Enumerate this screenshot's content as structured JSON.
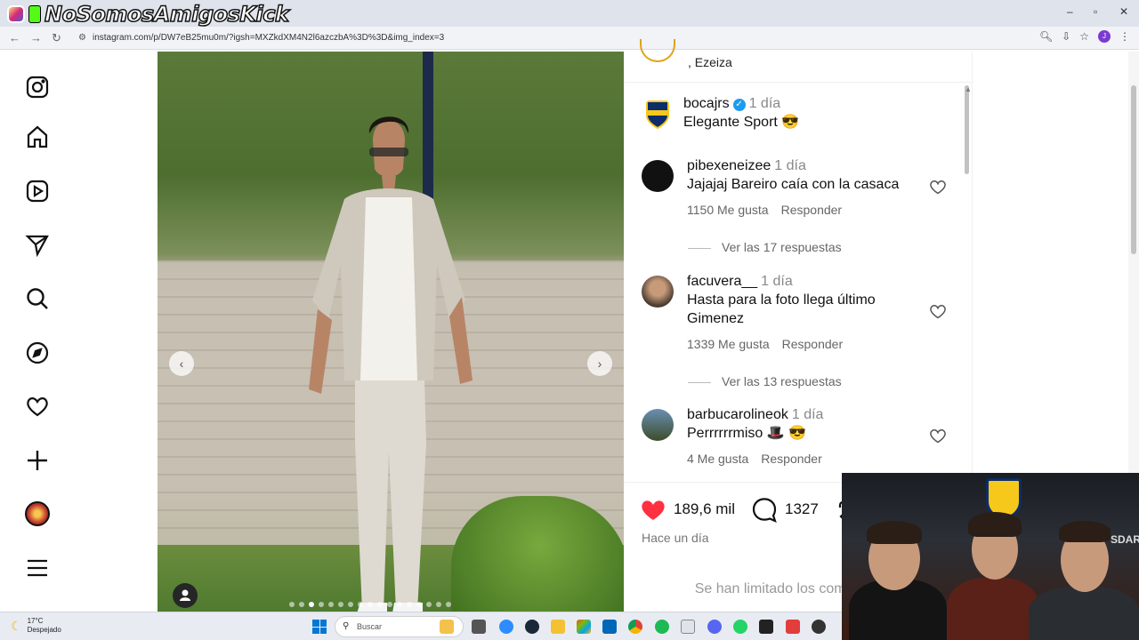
{
  "overlay": {
    "channel_handle": "NoSomosAmigosKick"
  },
  "browser": {
    "url": "instagram.com/p/DW7eB25mu0m/?igsh=MXZkdXM4N2l6azczbA%3D%3D&img_index=3",
    "window_controls": [
      "minimize-icon",
      "restore-icon",
      "close-icon"
    ],
    "profile_initial": "J"
  },
  "sidebar": {
    "items": [
      {
        "icon": "instagram-logo-icon"
      },
      {
        "icon": "home-icon"
      },
      {
        "icon": "reels-icon"
      },
      {
        "icon": "messages-icon"
      },
      {
        "icon": "search-icon"
      },
      {
        "icon": "explore-icon"
      },
      {
        "icon": "notifications-heart-icon"
      },
      {
        "icon": "create-plus-icon"
      },
      {
        "icon": "profile-avatar"
      },
      {
        "icon": "menu-icon"
      }
    ]
  },
  "post": {
    "location_partial": ", Ezeiza",
    "carousel": {
      "current_index": 3,
      "total_dots": 17
    },
    "caption": {
      "user": "bocajrs",
      "time": "1 día",
      "verified": true,
      "text": "Elegante Sport 😎"
    },
    "comments": [
      {
        "user": "pibexeneizee",
        "time": "1 día",
        "text": "Jajajaj Bareiro caía con la casaca",
        "likes": "1150 Me gusta",
        "reply": "Responder",
        "view_replies": "Ver las 17 respuestas"
      },
      {
        "user": "facuvera__",
        "time": "1 día",
        "text": "Hasta para la foto llega último Gimenez",
        "likes": "1339 Me gusta",
        "reply": "Responder",
        "view_replies": "Ver las 13 respuestas"
      },
      {
        "user": "barbucarolineok",
        "time": "1 día",
        "text": "Perrrrrrmiso 🎩 😎",
        "likes": "4 Me gusta",
        "reply": "Responder"
      }
    ],
    "likes_count": "189,6 mil",
    "comments_count": "1327",
    "posted": "Hace un día",
    "comments_limited_text": "Se han limitado los comen publicación."
  },
  "webcam": {
    "partial_sign": "SDAR"
  },
  "taskbar": {
    "weather_temp": "17°C",
    "weather_desc": "Despejado",
    "search_placeholder": "Buscar"
  },
  "colors": {
    "like_red": "#ff3040",
    "verified_blue": "#1d9bf0",
    "boca_yellow": "#f7c81c",
    "boca_blue": "#0b2d6b"
  }
}
